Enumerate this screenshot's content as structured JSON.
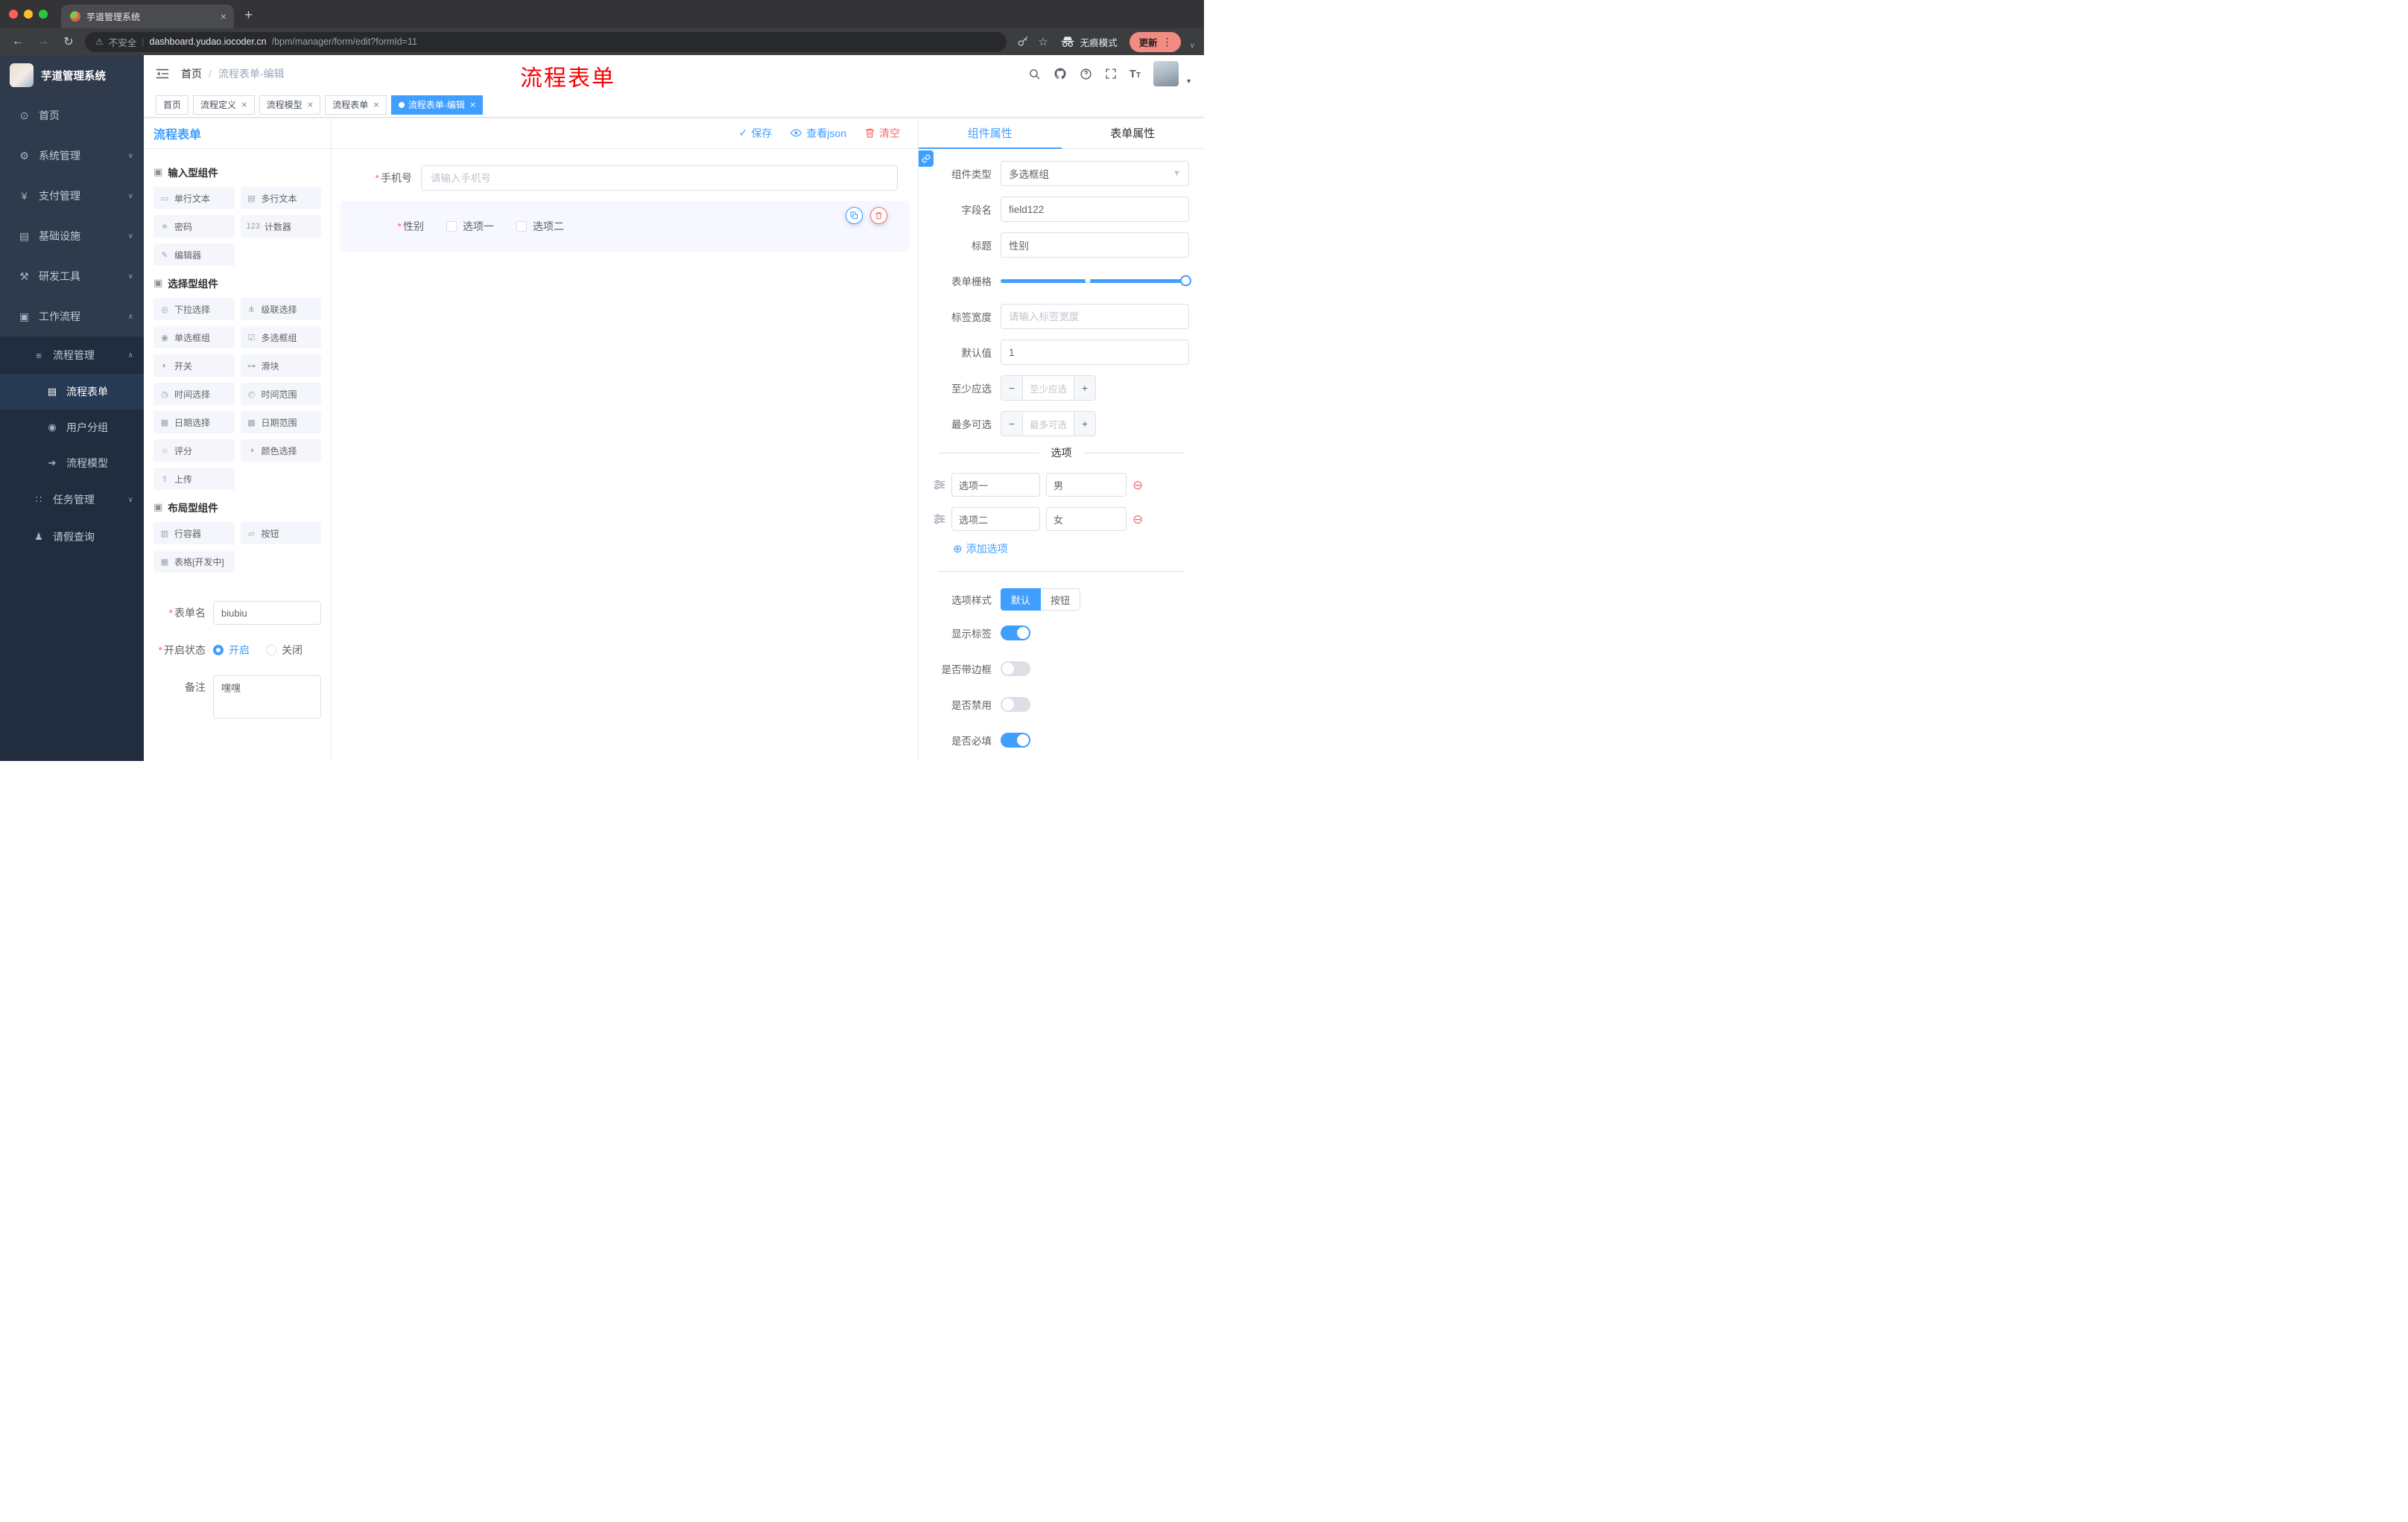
{
  "icons": {
    "close": "×",
    "plus": "+",
    "back": "←",
    "forward": "→",
    "reload": "↻",
    "warning": "⚠",
    "divider": "|",
    "star": "☆",
    "kebab": "⋮",
    "chevron_down": "∨",
    "chevron_up": "∧",
    "caret_down": "▼",
    "select_caret": "▼",
    "breadcrumb_sep": "/",
    "required": "*",
    "check": "✓",
    "minus": "−",
    "add_circle": "⊕",
    "remove_circle": "⊖",
    "text_big": "T",
    "text_small": "T"
  },
  "browser": {
    "tab_title": "芋道管理系统",
    "security_label": "不安全",
    "url_domain": "dashboard.yudao.iocoder.cn",
    "url_path": "/bpm/manager/form/edit?formId=11",
    "incognito_label": "无痕模式",
    "update_label": "更新"
  },
  "sidebar": {
    "logo_title": "芋道管理系统",
    "items": [
      {
        "icon": "⊙",
        "label": "首页",
        "chevron": ""
      },
      {
        "icon": "⚙",
        "label": "系统管理",
        "chevron": "∨"
      },
      {
        "icon": "¥",
        "label": "支付管理",
        "chevron": "∨"
      },
      {
        "icon": "▤",
        "label": "基础设施",
        "chevron": "∨"
      },
      {
        "icon": "⚒",
        "label": "研发工具",
        "chevron": "∨"
      },
      {
        "icon": "▣",
        "label": "工作流程",
        "chevron": "∧"
      }
    ],
    "submenu": [
      {
        "icon": "≡",
        "label": "流程管理",
        "chevron": "∧"
      },
      {
        "icon": "▤",
        "label": "流程表单"
      },
      {
        "icon": "◉",
        "label": "用户分组"
      },
      {
        "icon": "➔",
        "label": "流程模型"
      },
      {
        "icon": "∷",
        "label": "任务管理",
        "chevron": "∨"
      },
      {
        "icon": "♟",
        "label": "请假查询"
      }
    ]
  },
  "topbar": {
    "breadcrumb_home": "首页",
    "breadcrumb_current": "流程表单-编辑",
    "annotation": "流程表单"
  },
  "tags": [
    {
      "label": "首页"
    },
    {
      "label": "流程定义"
    },
    {
      "label": "流程模型"
    },
    {
      "label": "流程表单"
    },
    {
      "label": "流程表单-编辑"
    }
  ],
  "palette": {
    "title": "流程表单",
    "groups": [
      {
        "icon": "▣",
        "title": "输入型组件",
        "items": [
          {
            "icon": "▭",
            "label": "单行文本"
          },
          {
            "icon": "▤",
            "label": "多行文本"
          },
          {
            "icon": "✳",
            "label": "密码"
          },
          {
            "icon": "123",
            "label": "计数器"
          },
          {
            "icon": "✎",
            "label": "编辑器"
          }
        ]
      },
      {
        "icon": "▣",
        "title": "选择型组件",
        "items": [
          {
            "icon": "◎",
            "label": "下拉选择"
          },
          {
            "icon": "⋔",
            "label": "级联选择"
          },
          {
            "icon": "◉",
            "label": "单选框组"
          },
          {
            "icon": "☑",
            "label": "多选框组"
          },
          {
            "icon": "◐",
            "label": "开关"
          },
          {
            "icon": "⊶",
            "label": "滑块"
          },
          {
            "icon": "◷",
            "label": "时间选择"
          },
          {
            "icon": "◴",
            "label": "时间范围"
          },
          {
            "icon": "▦",
            "label": "日期选择"
          },
          {
            "icon": "▩",
            "label": "日期范围"
          },
          {
            "icon": "☆",
            "label": "评分"
          },
          {
            "icon": "◑",
            "label": "颜色选择"
          },
          {
            "icon": "⇧",
            "label": "上传"
          }
        ]
      },
      {
        "icon": "▣",
        "title": "布局型组件",
        "items": [
          {
            "icon": "▥",
            "label": "行容器"
          },
          {
            "icon": "▱",
            "label": "按钮"
          },
          {
            "icon": "▦",
            "label": "表格[开发中]"
          }
        ]
      }
    ],
    "form": {
      "name_label": "表单名",
      "name_value": "biubiu",
      "status_label": "开启状态",
      "status_on": "开启",
      "status_off": "关闭",
      "remark_label": "备注",
      "remark_value": "嘿嘿"
    }
  },
  "canvas": {
    "save_label": "保存",
    "viewjson_label": "查看json",
    "clear_label": "清空",
    "phone_label": "手机号",
    "phone_placeholder": "请输入手机号",
    "gender_label": "性别",
    "gender_options": [
      "选项一",
      "选项二"
    ]
  },
  "props": {
    "tab_component": "组件属性",
    "tab_form": "表单属性",
    "type_label": "组件类型",
    "type_value": "多选框组",
    "field_label": "字段名",
    "field_value": "field122",
    "title_label": "标题",
    "title_value": "性别",
    "grid_label": "表单栅格",
    "width_label": "标签宽度",
    "width_placeholder": "请输入标签宽度",
    "default_label": "默认值",
    "default_value": "1",
    "min_label": "至少应选",
    "min_placeholder": "至少应选",
    "max_label": "最多可选",
    "max_placeholder": "最多可选",
    "options_title": "选项",
    "options": [
      {
        "label": "选项一",
        "value": "男"
      },
      {
        "label": "选项二",
        "value": "女"
      }
    ],
    "add_option_label": "添加选项",
    "style_label": "选项样式",
    "style_default": "默认",
    "style_button": "按钮",
    "toggles": [
      {
        "label": "显示标签",
        "on": true
      },
      {
        "label": "是否带边框",
        "on": false
      },
      {
        "label": "是否禁用",
        "on": false
      },
      {
        "label": "是否必填",
        "on": true
      }
    ]
  }
}
